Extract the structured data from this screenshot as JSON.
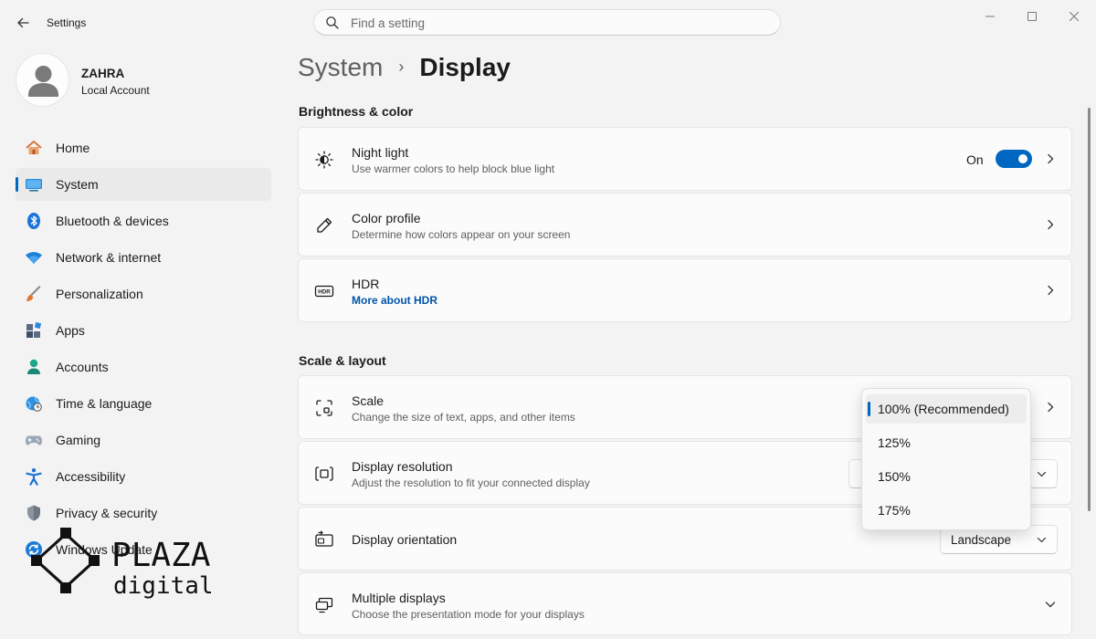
{
  "window": {
    "title": "Settings"
  },
  "search": {
    "placeholder": "Find a setting"
  },
  "user": {
    "name": "ZAHRA",
    "account_type": "Local Account"
  },
  "nav": [
    {
      "label": "Home",
      "icon": "home-icon"
    },
    {
      "label": "System",
      "icon": "system-display-icon",
      "active": true
    },
    {
      "label": "Bluetooth & devices",
      "icon": "bluetooth-icon"
    },
    {
      "label": "Network & internet",
      "icon": "wifi-icon"
    },
    {
      "label": "Personalization",
      "icon": "paintbrush-icon"
    },
    {
      "label": "Apps",
      "icon": "apps-icon"
    },
    {
      "label": "Accounts",
      "icon": "accounts-icon"
    },
    {
      "label": "Time & language",
      "icon": "globe-clock-icon"
    },
    {
      "label": "Gaming",
      "icon": "gamepad-icon"
    },
    {
      "label": "Accessibility",
      "icon": "accessibility-icon"
    },
    {
      "label": "Privacy & security",
      "icon": "shield-icon"
    },
    {
      "label": "Windows Update",
      "icon": "update-icon"
    }
  ],
  "breadcrumb": {
    "parent": "System",
    "separator": "›",
    "current": "Display"
  },
  "brightness": {
    "heading": "Brightness & color",
    "night_light": {
      "title": "Night light",
      "subtitle": "Use warmer colors to help block blue light",
      "state_label": "On",
      "enabled": true
    },
    "color_profile": {
      "title": "Color profile",
      "subtitle": "Determine how colors appear on your screen"
    },
    "hdr": {
      "title": "HDR",
      "link": "More about HDR"
    }
  },
  "layout": {
    "heading": "Scale & layout",
    "scale": {
      "title": "Scale",
      "subtitle": "Change the size of text, apps, and other items"
    },
    "resolution": {
      "title": "Display resolution",
      "subtitle": "Adjust the resolution to fit your connected display"
    },
    "orientation": {
      "title": "Display orientation",
      "value": "Landscape"
    },
    "multiple": {
      "title": "Multiple displays",
      "subtitle": "Choose the presentation mode for your displays"
    }
  },
  "scale_dropdown": {
    "options": [
      "100% (Recommended)",
      "125%",
      "150%",
      "175%"
    ],
    "selected_index": 0
  },
  "watermark": {
    "line1": "PLAZA",
    "line2": "digital"
  },
  "colors": {
    "accent": "#0067c0",
    "link": "#0055a8",
    "background": "#f3f3f3",
    "card": "#fbfbfb"
  }
}
